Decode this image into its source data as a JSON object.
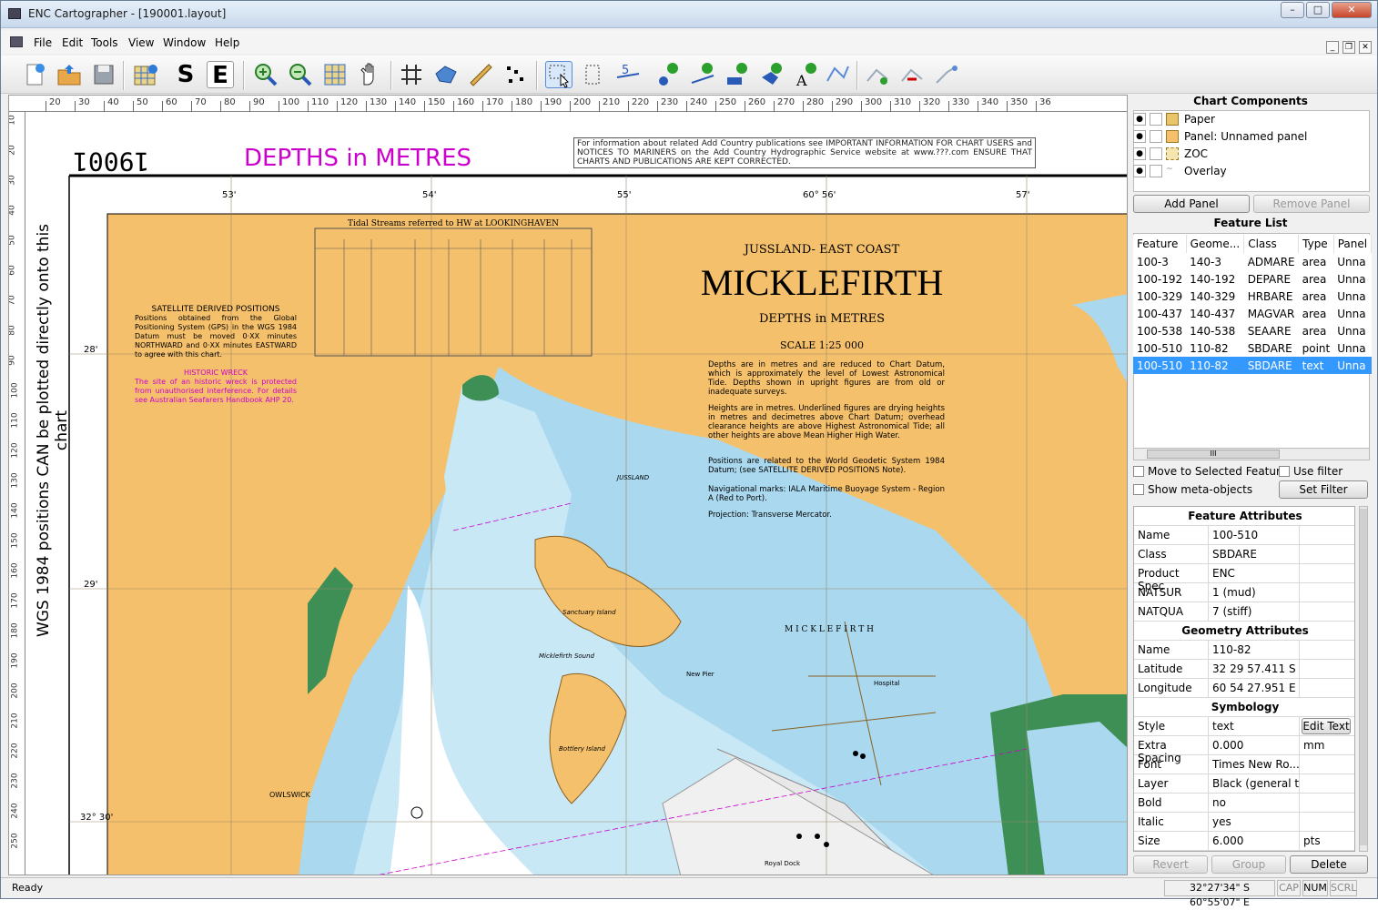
{
  "window": {
    "title": "ENC Cartographer - [190001.layout]",
    "minimize": "–",
    "maximize": "□",
    "close": "✕"
  },
  "menu": [
    "File",
    "Edit",
    "Tools",
    "View",
    "Window",
    "Help"
  ],
  "mdi_controls": {
    "min": "_",
    "restore": "❐",
    "close": "✕"
  },
  "toolbar": {
    "buttons": [
      "new",
      "open",
      "save",
      "chart-properties",
      "S",
      "E",
      "zoom-in",
      "zoom-out",
      "zoom-extent",
      "pan",
      "grid",
      "area",
      "measure",
      "select-points",
      "select",
      "select-rect",
      "depth-label",
      "add-point",
      "add-line",
      "add-area",
      "add-area-fill",
      "add-text",
      "add-polyline",
      "edit-vertices",
      "insert-vertex",
      "delete-vertex",
      "move-vertex"
    ]
  },
  "ruler": {
    "h": [
      "20",
      "30",
      "40",
      "50",
      "60",
      "70",
      "80",
      "90",
      "100",
      "110",
      "120",
      "130",
      "140",
      "150",
      "160",
      "170",
      "180",
      "190",
      "200",
      "210",
      "220",
      "230",
      "240",
      "250",
      "260",
      "270",
      "280",
      "290",
      "300",
      "310",
      "320",
      "330",
      "340",
      "350",
      "36"
    ],
    "v": [
      "10",
      "20",
      "30",
      "40",
      "50",
      "60",
      "70",
      "80",
      "90",
      "100",
      "110",
      "120",
      "130",
      "140",
      "150",
      "160",
      "170",
      "180",
      "190",
      "200",
      "210",
      "220",
      "230",
      "240",
      "250"
    ]
  },
  "chart": {
    "chart_number": "19001",
    "depths_heading": "DEPTHS in METRES",
    "info_note": "For information about related Add Country publications see IMPORTANT INFORMATION FOR CHART USERS and NOTICES TO MARINERS on the Add Country Hydrographic Service website at www.???.com ENSURE THAT CHARTS AND PUBLICATIONS ARE KEPT CORRECTED.",
    "wgs_note": "WGS 1984 positions CAN be plotted directly onto this chart",
    "lon_ticks": [
      "53'",
      "54'",
      "55'",
      "60° 56'",
      "57'"
    ],
    "lat_ticks": [
      "28'",
      "29'",
      "32° 30'"
    ],
    "region": "JUSSLAND- EAST COAST",
    "name": "MICKLEFIRTH",
    "sub": "DEPTHS in METRES",
    "scale": "SCALE 1:25 000",
    "depths_text": "Depths are in metres and are reduced to Chart Datum, which is approximately the level of Lowest Astronomical Tide. Depths shown in upright figures are from old or inadequate surveys.",
    "heights_text": "Heights are in metres. Underlined figures are drying heights in metres and decimetres above Chart Datum; overhead clearance heights are above Highest Astronomical Tide; all other heights are above Mean Higher High Water.",
    "positions_text": "Positions are related to the World Geodetic System 1984 Datum; (see SATELLITE DERIVED POSITIONS Note).",
    "nav_text": "Navigational marks: IALA Maritime Buoyage System - Region A (Red to Port).",
    "projection_text": "Projection: Transverse Mercator.",
    "tidal_title": "Tidal Streams referred to HW at LOOKINGHAVEN",
    "satellite_title": "SATELLITE DERIVED POSITIONS",
    "satellite_text": "Positions obtained from the Global Positioning System (GPS) in the WGS 1984 Datum must be moved 0·XX minutes NORTHWARD and 0·XX minutes EASTWARD to agree with this chart.",
    "wreck_title": "HISTORIC WRECK",
    "wreck_text": "The site of an historic wreck is protected from unauthorised interference. For details see Australian Seafarers Handbook AHP 20.",
    "places": {
      "micklefirth_town": "M I C K L E F I R T H",
      "owlswick": "OWLSWICK",
      "jussland": "JUSSLAND",
      "hospital": "Hospital",
      "new_pier": "New Pier",
      "royal_dock": "Royal Dock",
      "micklefirth_sound": "Micklefirth Sound",
      "bottlery_island": "Bottlery Island",
      "sanctuary_island": "Sanctuary Island"
    }
  },
  "components": {
    "title": "Chart Components",
    "items": [
      "Paper",
      "Panel: Unnamed panel",
      "ZOC",
      "Overlay"
    ],
    "add_panel": "Add Panel",
    "remove_panel": "Remove Panel"
  },
  "feature_list": {
    "title": "Feature List",
    "columns": [
      "Feature",
      "Geome...",
      "Class",
      "Type",
      "Panel"
    ],
    "rows": [
      [
        "100-3",
        "140-3",
        "ADMARE",
        "area",
        "Unna"
      ],
      [
        "100-192",
        "140-192",
        "DEPARE",
        "area",
        "Unna"
      ],
      [
        "100-329",
        "140-329",
        "HRBARE",
        "area",
        "Unna"
      ],
      [
        "100-437",
        "140-437",
        "MAGVAR",
        "area",
        "Unna"
      ],
      [
        "100-538",
        "140-538",
        "SEAARE",
        "area",
        "Unna"
      ],
      [
        "100-510",
        "110-82",
        "SBDARE",
        "point",
        "Unna"
      ],
      [
        "100-510",
        "110-82",
        "SBDARE",
        "text",
        "Unna"
      ]
    ],
    "selected_index": 6,
    "scroll_mark": "III",
    "move_to_selected": "Move to Selected Feature",
    "use_filter": "Use filter",
    "show_meta": "Show meta-objects",
    "set_filter": "Set Filter"
  },
  "attributes": {
    "feature_header": "Feature Attributes",
    "feature_rows": [
      [
        "Name",
        "100-510"
      ],
      [
        "Class",
        "SBDARE"
      ],
      [
        "Product Spec",
        "ENC"
      ],
      [
        "NATSUR",
        "1 (mud)"
      ],
      [
        "NATQUA",
        "7 (stiff)"
      ]
    ],
    "geometry_header": "Geometry Attributes",
    "geometry_rows": [
      [
        "Name",
        "110-82"
      ],
      [
        "Latitude",
        "32 29 57.411 S"
      ],
      [
        "Longitude",
        "60 54 27.951 E"
      ]
    ],
    "symbology_header": "Symbology",
    "symbology_rows": [
      [
        "Style",
        "text",
        "Edit Text"
      ],
      [
        "Extra Spacing",
        "0.000",
        "mm"
      ],
      [
        "Font",
        "Times New Ro...",
        ""
      ],
      [
        "Layer",
        "Black (general t...",
        ""
      ],
      [
        "Bold",
        "no",
        ""
      ],
      [
        "Italic",
        "yes",
        ""
      ],
      [
        "Size",
        "6.000",
        "pts"
      ]
    ],
    "revert": "Revert",
    "group": "Group",
    "delete": "Delete"
  },
  "status": {
    "text": "Ready",
    "coords": "32°27'34\" S 60°55'07\" E",
    "cap": "CAP",
    "num": "NUM",
    "scrl": "SCRL"
  },
  "colors": {
    "land": "#f5c06b",
    "shallow": "#a9d8ef",
    "medium": "#c9e8f6",
    "deep": "#ffffff",
    "intertidal": "#3e8f55",
    "magenta": "#cc00cc",
    "selection": "#3399ff"
  }
}
